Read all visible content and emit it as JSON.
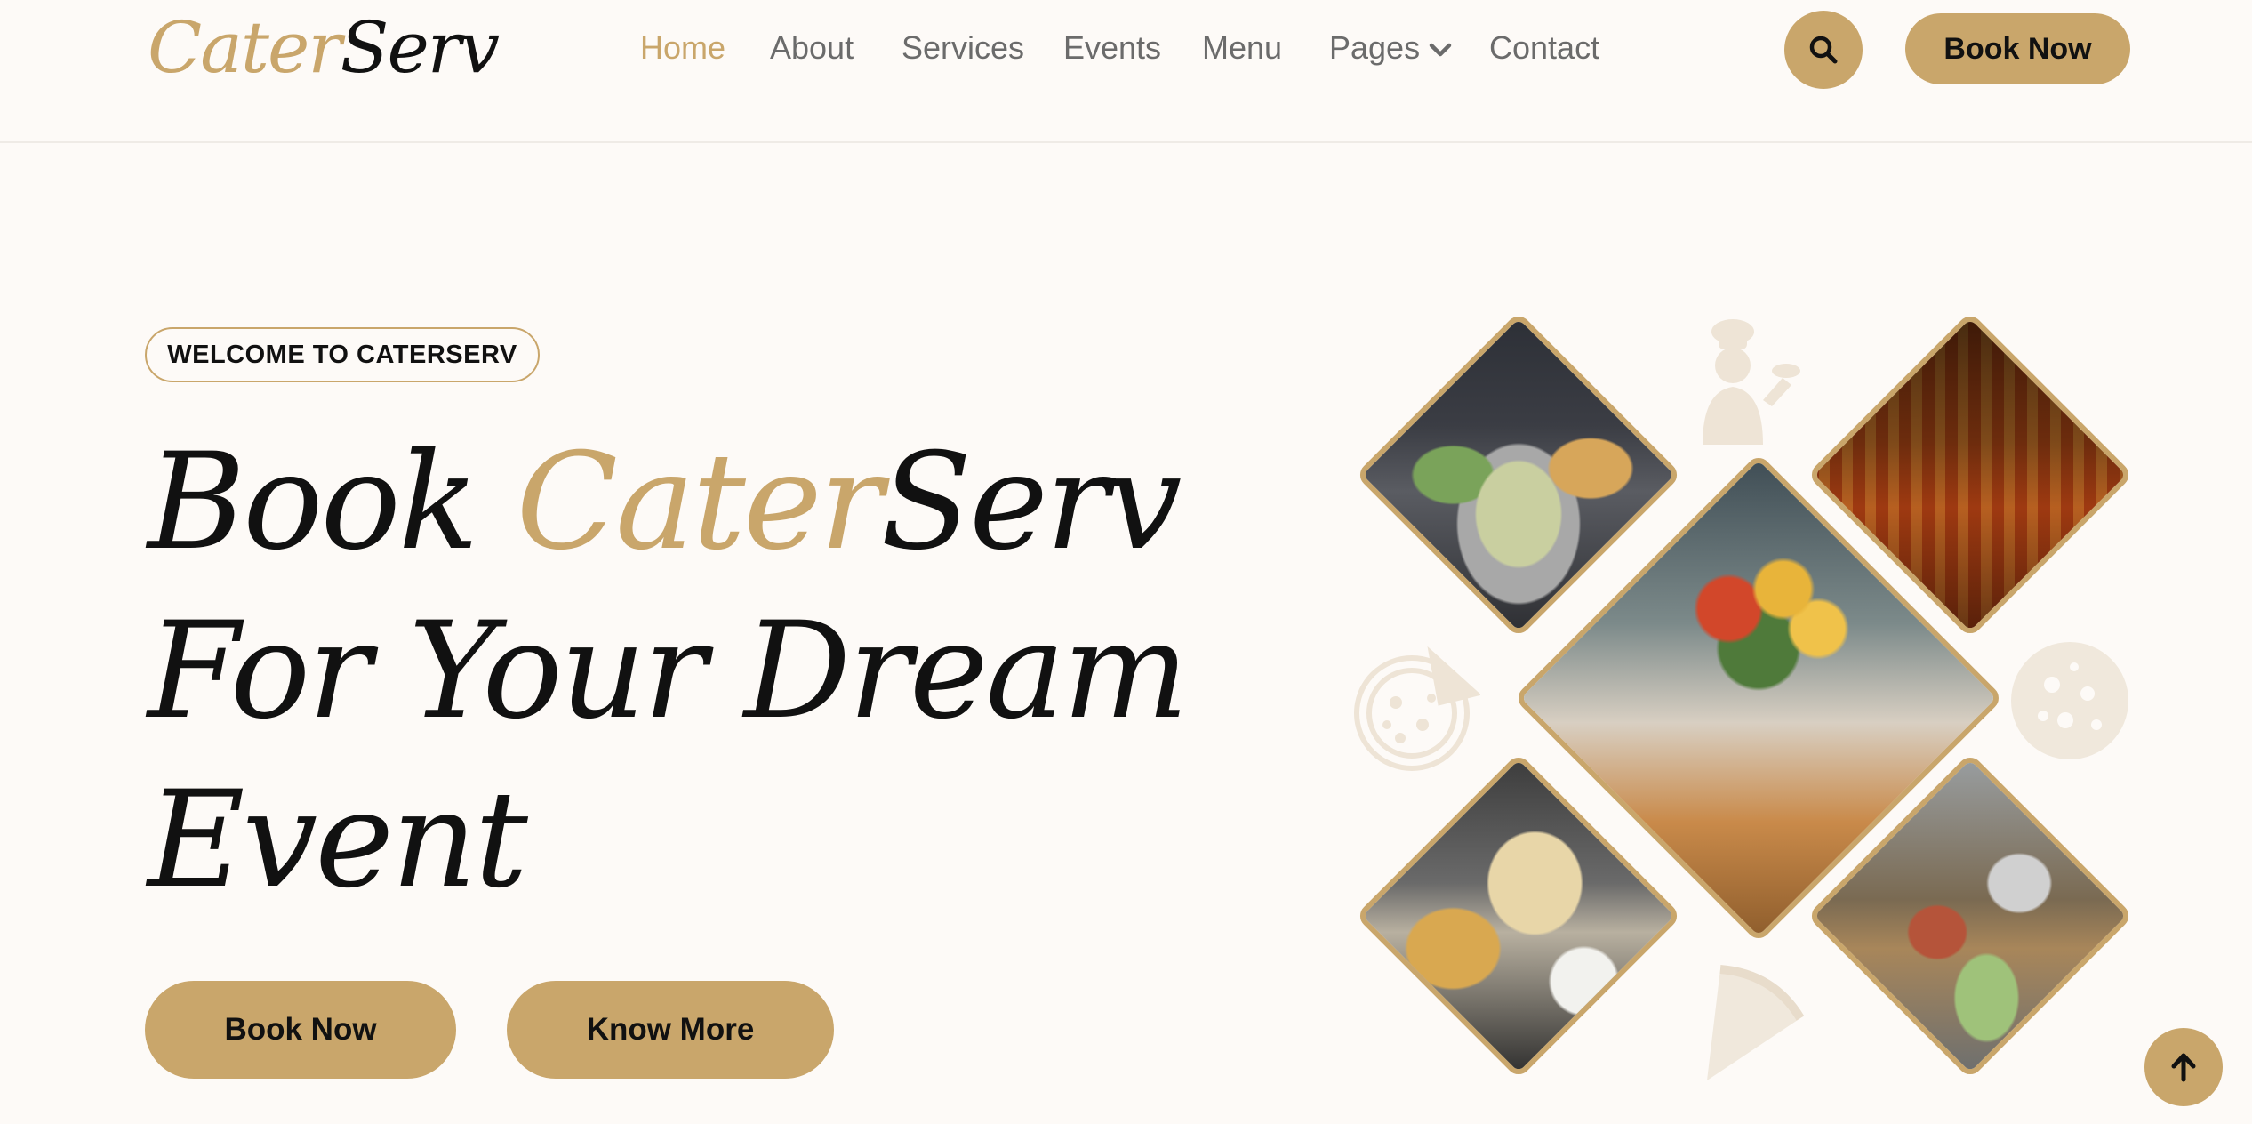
{
  "brand": {
    "part1": "Cater",
    "part2": "Serv"
  },
  "nav": {
    "items": [
      "Home",
      "About",
      "Services",
      "Events",
      "Menu",
      "Pages",
      "Contact"
    ],
    "active": "Home"
  },
  "header": {
    "book_now": "Book Now"
  },
  "hero": {
    "badge": "WELCOME TO CATERSERV",
    "headline": {
      "line1_prefix": "Book ",
      "line1_gold": "Cater",
      "line1_suffix": "Serv",
      "line2": "For Your Dream",
      "line3": "Event"
    },
    "book_now": "Book Now",
    "know_more": "Know More"
  },
  "colors": {
    "accent": "#c9a66b",
    "background": "#fdfaf7",
    "text_dark": "#111111",
    "nav_text": "#6b6b6b"
  },
  "icons": {
    "search": "search-icon",
    "pages_dropdown": "chevron-down-icon",
    "back_to_top": "arrow-up-icon",
    "decor_chef": "chef-icon",
    "decor_pizza": "pizza-icon"
  }
}
